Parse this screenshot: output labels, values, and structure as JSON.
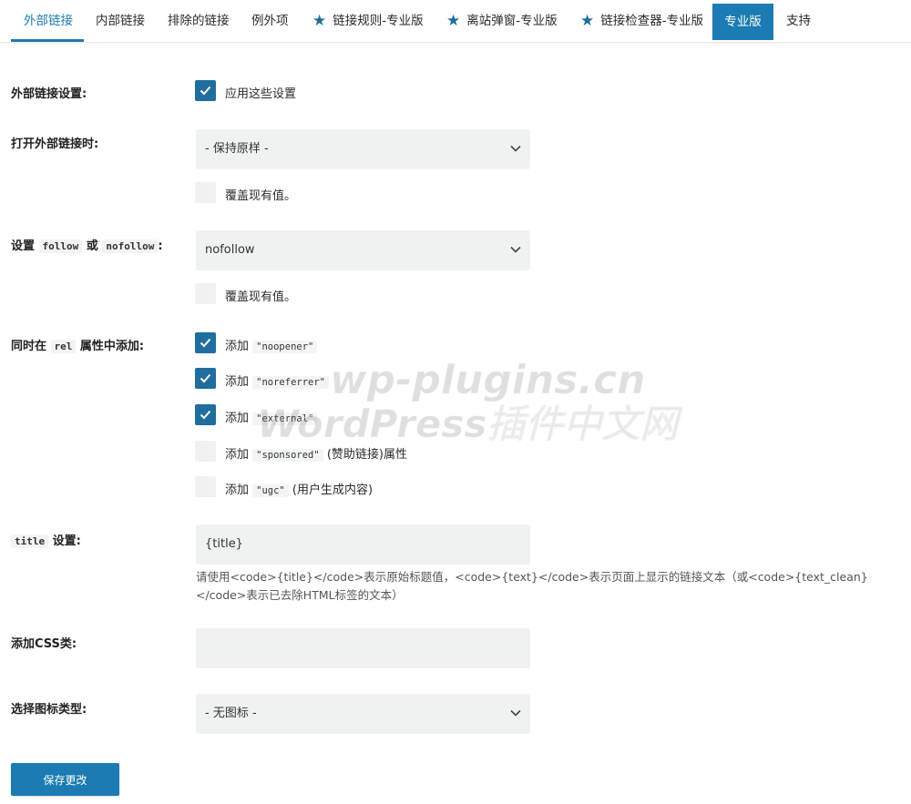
{
  "tabs": {
    "items": [
      {
        "label": "外部链接"
      },
      {
        "label": "内部链接"
      },
      {
        "label": "排除的链接"
      },
      {
        "label": "例外项"
      },
      {
        "label": "链接规则-专业版"
      },
      {
        "label": "离站弹窗-专业版"
      },
      {
        "label": "链接检查器-专业版"
      }
    ],
    "pro_label": "专业版",
    "support_label": "支持"
  },
  "settings": {
    "apply": {
      "label": "外部链接设置:",
      "checkbox_label": "应用这些设置",
      "checked": true
    },
    "open": {
      "label": "打开外部链接时:",
      "value": "- 保持原样 -",
      "override_label": "覆盖现有值。",
      "override_checked": false
    },
    "follow": {
      "label_pre": "设置 ",
      "code1": "follow",
      "label_mid": " 或 ",
      "code2": "nofollow",
      "label_post": ":",
      "value": "nofollow",
      "override_label": "覆盖现有值。",
      "override_checked": false
    },
    "rel": {
      "label_pre": "同时在 ",
      "code": "rel",
      "label_post": " 属性中添加:",
      "options": [
        {
          "prefix": "添加 ",
          "code": "\"noopener\"",
          "suffix": "",
          "checked": true
        },
        {
          "prefix": "添加 ",
          "code": "\"noreferrer\"",
          "suffix": "",
          "checked": true
        },
        {
          "prefix": "添加 ",
          "code": "\"external\"",
          "suffix": "",
          "checked": true
        },
        {
          "prefix": "添加 ",
          "code": "\"sponsored\"",
          "suffix": " (赞助链接)属性",
          "checked": false
        },
        {
          "prefix": "添加 ",
          "code": "\"ugc\"",
          "suffix": " (用户生成内容)",
          "checked": false
        }
      ]
    },
    "title": {
      "code": "title",
      "label_post": " 设置:",
      "value": "{title}",
      "help": "请使用<code>{title}</code>表示原始标题值，<code>{text}</code>表示页面上显示的链接文本（或<code>{text_clean}</code>表示已去除HTML标签的文本）"
    },
    "css": {
      "label": "添加CSS类:",
      "value": ""
    },
    "icon": {
      "label": "选择图标类型:",
      "value": "- 无图标 -"
    }
  },
  "save_label": "保存更改",
  "watermark": {
    "line1": "wp-plugins.cn",
    "line2": "WordPress插件中文网"
  },
  "colors": {
    "accent": "#1b7bb2",
    "checkbox": "#1f6e9d",
    "field_bg": "#f0f2f2"
  }
}
